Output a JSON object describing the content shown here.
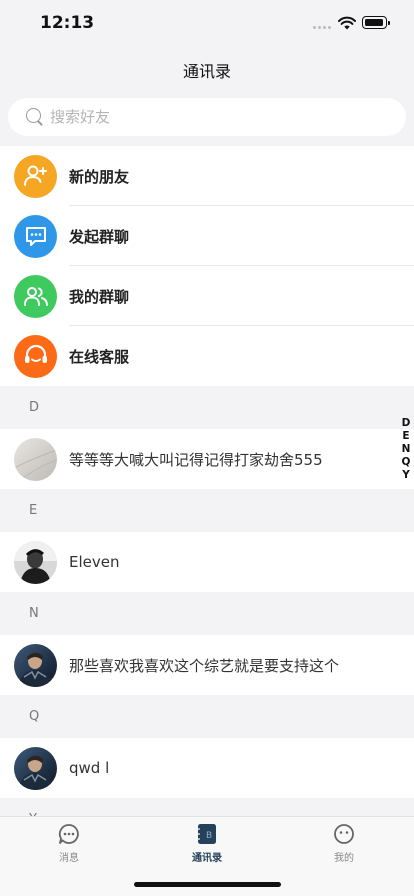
{
  "status_bar": {
    "time": "12:13"
  },
  "nav": {
    "title": "通讯录"
  },
  "search": {
    "placeholder": "搜索好友"
  },
  "functions": [
    {
      "label": "新的朋友",
      "icon": "add-friend-icon",
      "color": "#f5a623"
    },
    {
      "label": "发起群聊",
      "icon": "chat-bubble-icon",
      "color": "#2e97e8"
    },
    {
      "label": "我的群聊",
      "icon": "group-icon",
      "color": "#3fca5f"
    },
    {
      "label": "在线客服",
      "icon": "headset-icon",
      "color": "#fb6a16"
    }
  ],
  "sections": [
    {
      "letter": "D",
      "contacts": [
        {
          "name": "等等等大喊大叫记得记得打家劫舍555",
          "avatar": "paper-texture"
        }
      ]
    },
    {
      "letter": "E",
      "contacts": [
        {
          "name": "Eleven",
          "avatar": "dark-portrait"
        }
      ]
    },
    {
      "letter": "N",
      "contacts": [
        {
          "name": "那些喜欢我喜欢这个综艺就是要支持这个",
          "avatar": "armored-figure"
        }
      ]
    },
    {
      "letter": "Q",
      "contacts": [
        {
          "name": "qwd l",
          "avatar": "armored-figure"
        }
      ]
    },
    {
      "letter": "Y",
      "contacts": []
    }
  ],
  "index_letters": [
    "D",
    "E",
    "N",
    "Q",
    "Y"
  ],
  "tabs": [
    {
      "label": "消息",
      "icon": "message-icon"
    },
    {
      "label": "通讯录",
      "icon": "contacts-icon",
      "active": true
    },
    {
      "label": "我的",
      "icon": "profile-icon"
    }
  ],
  "colors": {
    "accent": "#25425a",
    "background": "#f3f3f5"
  }
}
